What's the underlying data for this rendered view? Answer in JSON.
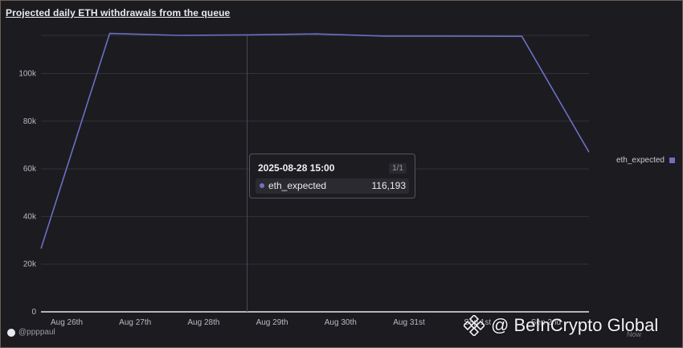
{
  "title": "Projected daily ETH withdrawals from the queue",
  "colors": {
    "line": "#6b6fc4",
    "background": "#1c1b20",
    "grid": "#33323a"
  },
  "chart_data": {
    "type": "line",
    "title": "Projected daily ETH withdrawals from the queue",
    "xlabel": "",
    "ylabel": "",
    "x": [
      "2025-08-25 15:00",
      "2025-08-26 15:00",
      "2025-08-27 15:00",
      "2025-08-28 15:00",
      "2025-08-29 15:00",
      "2025-08-30 15:00",
      "2025-08-31 15:00",
      "2025-09-01 15:00",
      "2025-09-02 15:00"
    ],
    "x_tick_labels": [
      "Aug 26th",
      "Aug 27th",
      "Aug 28th",
      "Aug 29th",
      "Aug 30th",
      "Aug 31st",
      "Sep 1st",
      "Sep 2nd"
    ],
    "y_tick_labels": [
      "0",
      "20k",
      "40k",
      "60k",
      "80k",
      "100k"
    ],
    "ylim": [
      0,
      116000
    ],
    "grid": true,
    "legend_position": "right",
    "series": [
      {
        "name": "eth_expected",
        "values": [
          26500,
          116800,
          116000,
          116193,
          116600,
          115700,
          115700,
          115600,
          67000
        ]
      }
    ]
  },
  "legend": {
    "label": "eth_expected"
  },
  "tooltip": {
    "time": "2025-08-28 15:00",
    "page": "1/1",
    "series_name": "eth_expected",
    "value": "116,193"
  },
  "credit": "@ppppaul",
  "watermark": "@ BeInCrypto Global",
  "now_hint": "Now"
}
